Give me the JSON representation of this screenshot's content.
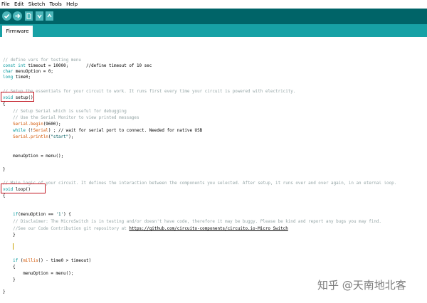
{
  "menu": [
    "File",
    "Edit",
    "Sketch",
    "Tools",
    "Help"
  ],
  "toolbar": {
    "verify": "verify-icon",
    "upload": "upload-icon",
    "new": "new-icon",
    "open": "open-icon",
    "save": "save-icon"
  },
  "tabs": [
    "Firmware"
  ],
  "code": {
    "l1": "// define vars for testing menu",
    "l2a": "const",
    "l2b": " int",
    "l2c": " timeout = 10000;       //define timeout of 10 sec",
    "l3a": "char",
    "l3b": " menuOption = 0;",
    "l4a": "long",
    "l4b": " time0;",
    "l5": "// Setup the essentials for your circuit to work. It runs first every time your circuit is powered with electricity.",
    "l6a": "void",
    "l6b": " setup()",
    "l7": "{",
    "l8": "    // Setup Serial which is useful for debugging",
    "l9": "    // Use the Serial Monitor to view printed messages",
    "l10a": "    Serial",
    "l10b": ".begin",
    "l10c": "(9600);",
    "l11a": "    while",
    "l11b": " (!",
    "l11c": "Serial",
    "l11d": ") ; // wait for serial port to connect. Needed for native USB",
    "l12a": "    Serial",
    "l12b": ".println",
    "l12c": "(",
    "l12d": "\"start\"",
    "l12e": ");",
    "l13": "    menuOption = menu();",
    "l14": "}",
    "l15": "// Main logic of your circuit. It defines the interaction between the components you selected. After setup, it runs over and over again, in an eternal loop.",
    "l16a": "void",
    "l16b": " loop()",
    "l17": "{",
    "l18a": "    if",
    "l18b": "(menuOption == ",
    "l18c": "'1'",
    "l18d": ") {",
    "l19": "    // Disclaimer: The MicroSwitch is in testing and/or doesn't have code, therefore it may be buggy. Please be kind and report any bugs you may find.",
    "l20a": "    //See our Code Contribution git repository at ",
    "l20b": "https://github.com/circuito-components/circuito.io-Micro_Switch",
    "l21": "    }",
    "l22a": "    if",
    "l22b": " (",
    "l22c": "millis",
    "l22d": "() - time0 > timeout)",
    "l23": "    {",
    "l24": "        menuOption = menu();",
    "l25": "    }",
    "l26": "}"
  },
  "watermark": "知乎 @天南地北客"
}
